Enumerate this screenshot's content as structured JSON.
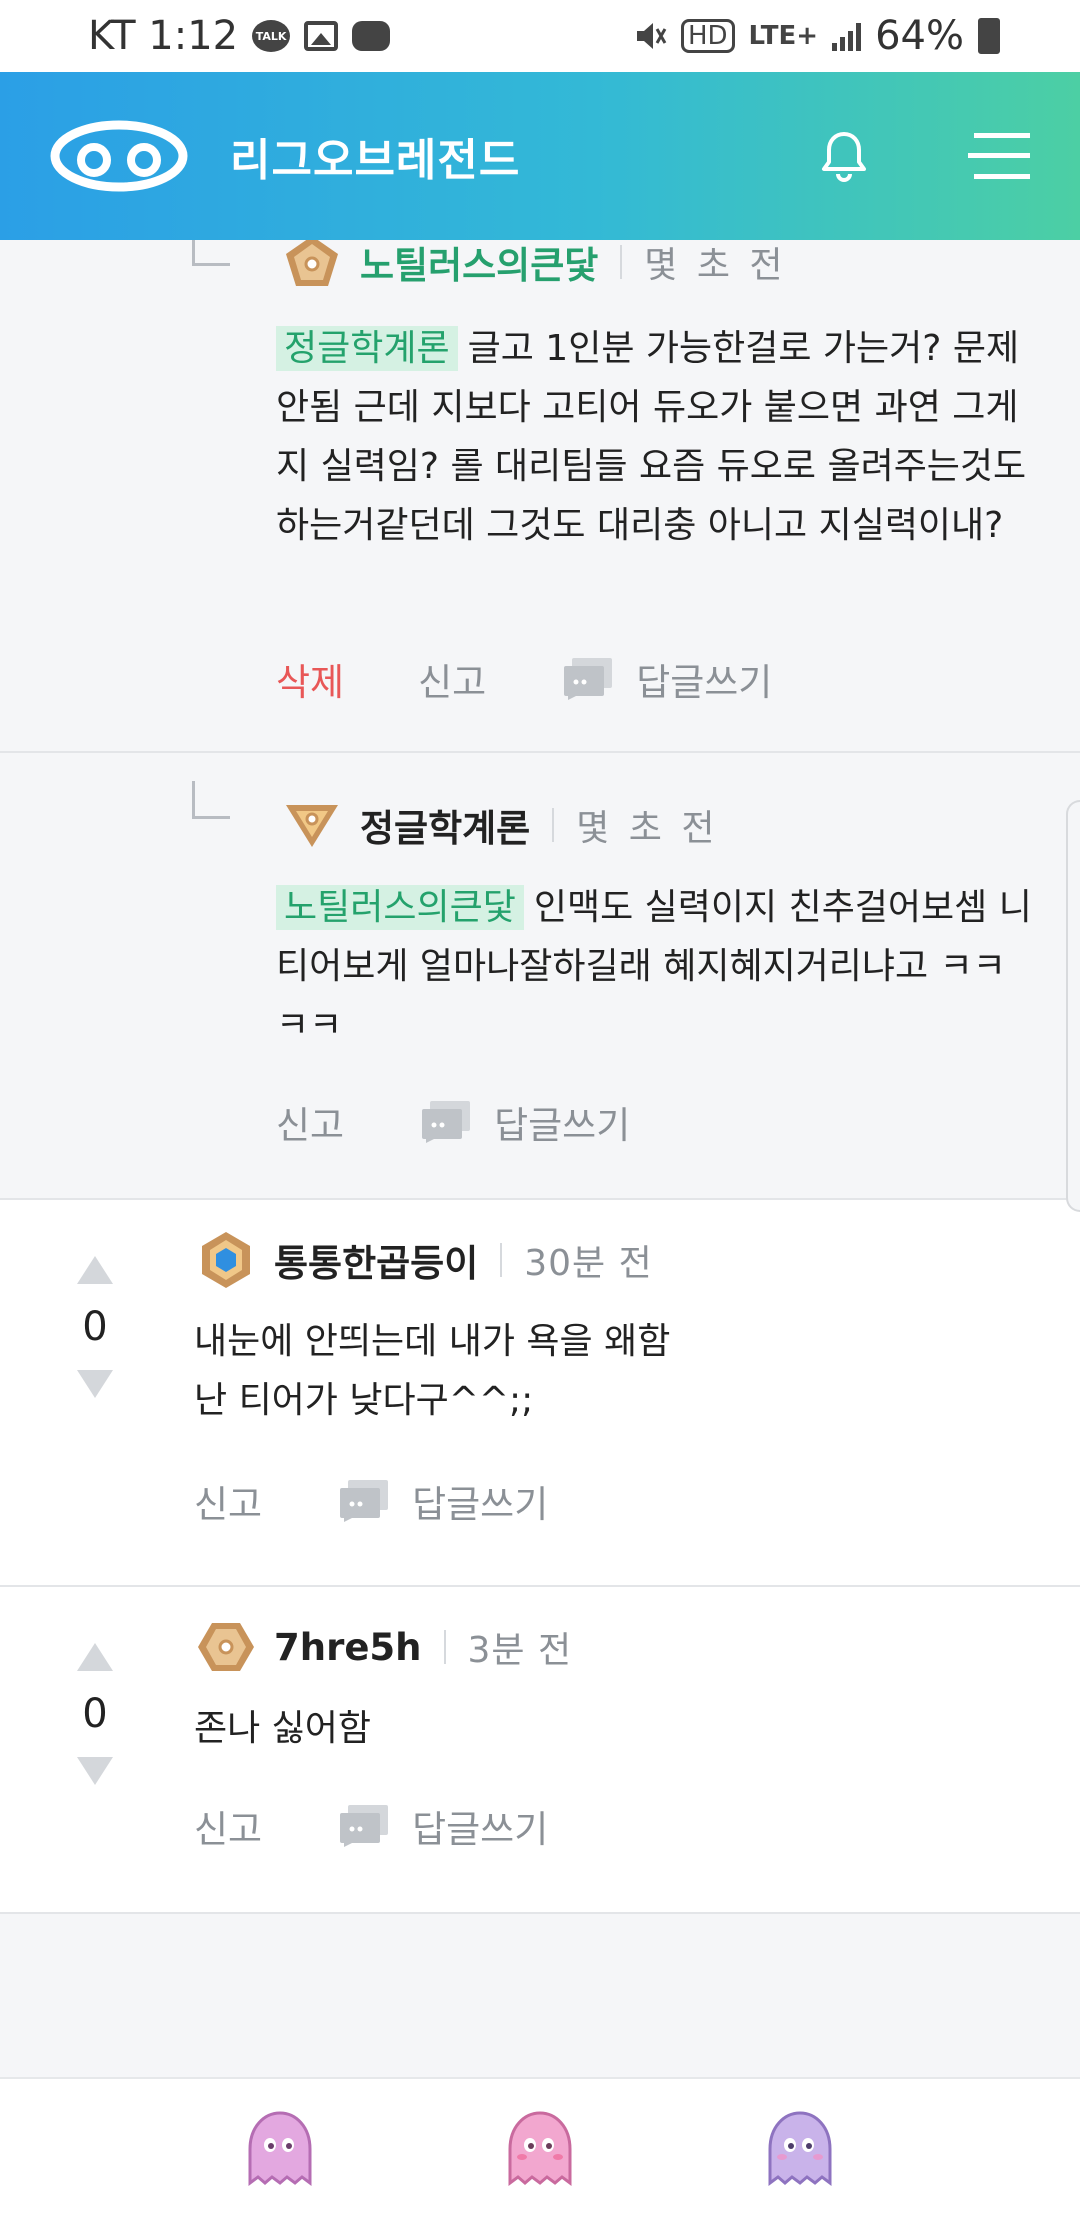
{
  "status_bar": {
    "carrier_time": "KT 1:12",
    "talk_label": "TALK",
    "hd_label": "HD",
    "lte_label": "LTE+",
    "battery": "64%"
  },
  "header": {
    "title": "리그오브레전드"
  },
  "replies": [
    {
      "author": "노틸러스의큰닻",
      "time": "몇 초 전",
      "mention": "정글학계론",
      "text": "글고 1인분 가능한걸로 가는거? 문제안됨 근데 지보다 고티어 듀오가 붙으면 과연 그게 지 실력임? 롤 대리팀들 요즘 듀오로 올려주는것도 하는거같던데 그것도 대리충 아니고 지실력이내?",
      "delete_label": "삭제",
      "report_label": "신고",
      "reply_label": "답글쓰기"
    },
    {
      "author": "정글학계론",
      "time": "몇 초 전",
      "mention": "노틸러스의큰닻",
      "text": "인맥도 실력이지 친추걸어보셈 니티어보게 얼마나잘하길래 혜지혜지거리냐고 ㅋㅋㅋㅋ",
      "report_label": "신고",
      "reply_label": "답글쓰기"
    }
  ],
  "comments": [
    {
      "votes": "0",
      "author": "통통한곱등이",
      "time": "30분 전",
      "text_line1": "내눈에 안띄는데 내가 욕을 왜함",
      "text_line2": "난 티어가 낮다구^^;;",
      "report_label": "신고",
      "reply_label": "답글쓰기"
    },
    {
      "votes": "0",
      "author": "7hre5h",
      "time": "3분 전",
      "text_line1": "존나 싫어함",
      "report_label": "신고",
      "reply_label": "답글쓰기"
    }
  ],
  "colors": {
    "header_start": "#2b9fe6",
    "header_end": "#4ccfa4",
    "mention_bg": "#d5f1e3",
    "mention_text": "#24a26c",
    "delete": "#e85757"
  },
  "icons": [
    "bell-icon",
    "menu-icon",
    "reply-bubble-icon",
    "ghost-icon",
    "tier-badge-icon"
  ]
}
